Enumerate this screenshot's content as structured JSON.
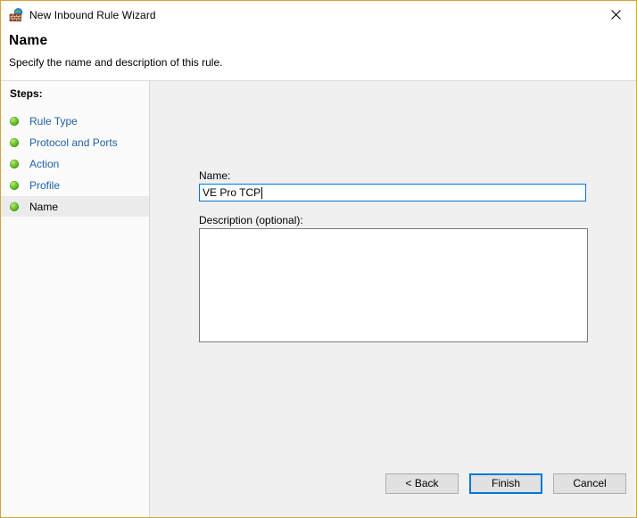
{
  "window": {
    "title": "New Inbound Rule Wizard",
    "icon": "firewall-globe-icon",
    "close_label": "✕",
    "border_color": "#d2a33c"
  },
  "header": {
    "title": "Name",
    "subtitle": "Specify the name and description of this rule."
  },
  "sidebar": {
    "heading": "Steps:",
    "items": [
      {
        "label": "Rule Type",
        "state": "done"
      },
      {
        "label": "Protocol and Ports",
        "state": "done"
      },
      {
        "label": "Action",
        "state": "done"
      },
      {
        "label": "Profile",
        "state": "done"
      },
      {
        "label": "Name",
        "state": "current"
      }
    ],
    "bullet_color": "#5cbe22"
  },
  "form": {
    "name_label": "Name:",
    "name_value": "VE Pro TCP",
    "name_placeholder": "",
    "description_label": "Description (optional):",
    "description_value": "",
    "description_placeholder": ""
  },
  "footer": {
    "back_label": "< Back",
    "finish_label": "Finish",
    "cancel_label": "Cancel",
    "default_button": "Finish",
    "accent_color": "#0078d7"
  }
}
